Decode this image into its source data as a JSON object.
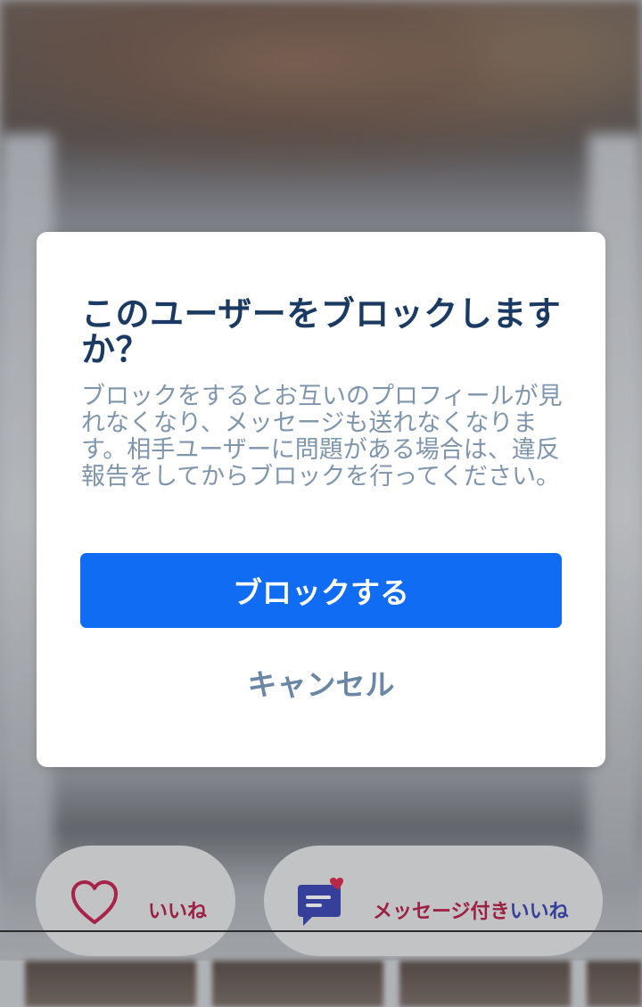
{
  "dialog": {
    "title": "このユーザーをブロックしますか？",
    "body": "ブロックをするとお互いのプロフィールが見れなくなり、メッセージも送れなくなります。相手ユーザーに問題がある場合は、違反報告をしてからブロックを行ってください。",
    "primary_label": "ブロックする",
    "cancel_label": "キャンセル"
  },
  "actions": {
    "like_label": "いいね",
    "message_like_label_part1": "メッセージ付き",
    "message_like_label_part2": "いいね"
  },
  "colors": {
    "primary": "#0f6cf3",
    "title": "#1b3a63",
    "body": "#7e95ad",
    "cancel": "#6a87a6",
    "like_accent": "#b61d48",
    "message_icon": "#3a45b3"
  },
  "icons": {
    "like": "heart-outline-icon",
    "message_like": "chat-bubble-heart-icon"
  }
}
